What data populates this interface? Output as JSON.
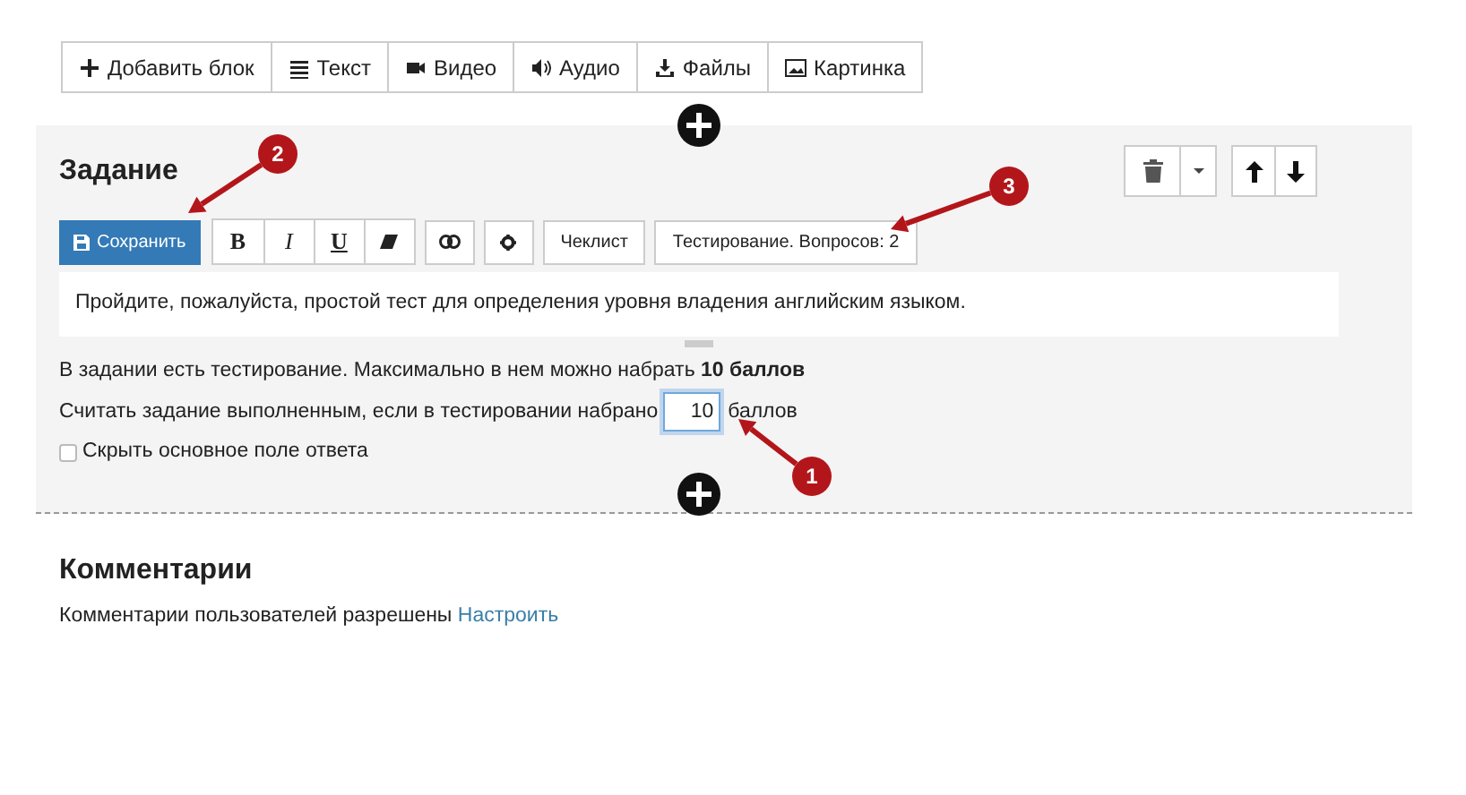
{
  "block_toolbar": [
    {
      "kind": "plus",
      "label": "Добавить блок"
    },
    {
      "kind": "text",
      "label": "Текст"
    },
    {
      "kind": "video",
      "label": "Видео"
    },
    {
      "kind": "audio",
      "label": "Аудио"
    },
    {
      "kind": "download",
      "label": "Файлы"
    },
    {
      "kind": "image",
      "label": "Картинка"
    }
  ],
  "task": {
    "title": "Задание",
    "save_button": "Сохранить",
    "format_buttons": [
      {
        "kind": "bold",
        "label": "B"
      },
      {
        "kind": "italic",
        "label": "I"
      },
      {
        "kind": "underline",
        "label": "U"
      },
      {
        "kind": "eraser"
      }
    ],
    "checklist_button": "Чеклист",
    "testing_button": "Тестирование. Вопросов: 2",
    "body": "Пройдите, пожалуйста, простой тест для определения уровня владения английским языком.",
    "info": "В задании есть тестирование. Максимально в нем можно набрать **10 баллов**",
    "threshold": {
      "label": "Считать задание выполненным, если в тестировании набрано",
      "value": "10",
      "focused": true,
      "suffix": "баллов"
    },
    "hide_answer": {
      "label": "Скрыть основное поле ответа",
      "checked": false
    }
  },
  "comments": {
    "title": "Комментарии",
    "text": "Комментарии пользователей разрешены",
    "link": "Настроить"
  },
  "annotations": [
    {
      "label": "2"
    },
    {
      "label": "3"
    },
    {
      "label": "1"
    }
  ]
}
